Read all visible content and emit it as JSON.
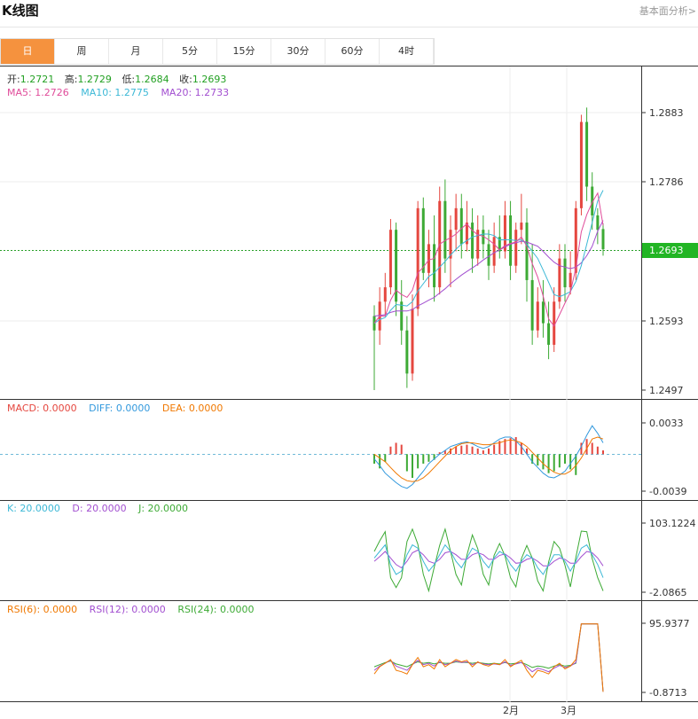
{
  "header": {
    "title": "K线图",
    "link": "基本面分析>"
  },
  "tabs": [
    {
      "label": "日",
      "active": true
    },
    {
      "label": "周"
    },
    {
      "label": "月"
    },
    {
      "label": "5分"
    },
    {
      "label": "15分"
    },
    {
      "label": "30分"
    },
    {
      "label": "60分"
    },
    {
      "label": "4时"
    }
  ],
  "colors": {
    "up": "#e5473f",
    "down": "#3daa35",
    "ma5": "#e04c9a",
    "ma10": "#3cb8d6",
    "ma20": "#a24fd0",
    "accent": "#f5923e",
    "dea": "#f07800",
    "diff": "#3399dd"
  },
  "info": {
    "open_label": "开:",
    "open": "1.2721",
    "high_label": "高:",
    "high": "1.2729",
    "low_label": "低:",
    "low": "1.2684",
    "close_label": "收:",
    "close": "1.2693",
    "ma5": "MA5: 1.2726",
    "ma10": "MA10: 1.2775",
    "ma20": "MA20: 1.2733"
  },
  "chart_data": [
    {
      "type": "candlestick",
      "title": "",
      "y_ticks": [
        "1.2883",
        "1.2786",
        "1.2693",
        "1.2593",
        "1.2497"
      ],
      "current_price": "1.2693",
      "ylim": [
        1.2497,
        1.291
      ],
      "x_ticks": [
        "2月",
        "3月"
      ],
      "ohlc": [
        [
          1.26,
          1.2615,
          1.2497,
          1.258
        ],
        [
          1.258,
          1.264,
          1.256,
          1.262
        ],
        [
          1.262,
          1.266,
          1.26,
          1.264
        ],
        [
          1.264,
          1.2735,
          1.263,
          1.272
        ],
        [
          1.272,
          1.273,
          1.26,
          1.262
        ],
        [
          1.262,
          1.265,
          1.256,
          1.258
        ],
        [
          1.258,
          1.26,
          1.25,
          1.252
        ],
        [
          1.252,
          1.263,
          1.251,
          1.261
        ],
        [
          1.261,
          1.276,
          1.26,
          1.275
        ],
        [
          1.275,
          1.2765,
          1.265,
          1.266
        ],
        [
          1.266,
          1.272,
          1.264,
          1.27
        ],
        [
          1.27,
          1.274,
          1.262,
          1.264
        ],
        [
          1.264,
          1.278,
          1.263,
          1.276
        ],
        [
          1.276,
          1.279,
          1.266,
          1.268
        ],
        [
          1.268,
          1.274,
          1.264,
          1.272
        ],
        [
          1.272,
          1.277,
          1.269,
          1.275
        ],
        [
          1.275,
          1.277,
          1.268,
          1.27
        ],
        [
          1.27,
          1.276,
          1.269,
          1.273
        ],
        [
          1.273,
          1.275,
          1.266,
          1.268
        ],
        [
          1.268,
          1.274,
          1.267,
          1.272
        ],
        [
          1.272,
          1.274,
          1.268,
          1.27
        ],
        [
          1.27,
          1.272,
          1.265,
          1.267
        ],
        [
          1.267,
          1.273,
          1.266,
          1.271
        ],
        [
          1.271,
          1.274,
          1.268,
          1.269
        ],
        [
          1.269,
          1.276,
          1.268,
          1.274
        ],
        [
          1.274,
          1.276,
          1.265,
          1.267
        ],
        [
          1.267,
          1.273,
          1.266,
          1.272
        ],
        [
          1.272,
          1.277,
          1.27,
          1.273
        ],
        [
          1.273,
          1.275,
          1.262,
          1.265
        ],
        [
          1.265,
          1.27,
          1.256,
          1.258
        ],
        [
          1.258,
          1.264,
          1.257,
          1.262
        ],
        [
          1.262,
          1.265,
          1.257,
          1.259
        ],
        [
          1.259,
          1.262,
          1.254,
          1.256
        ],
        [
          1.256,
          1.264,
          1.255,
          1.262
        ],
        [
          1.262,
          1.27,
          1.261,
          1.268
        ],
        [
          1.268,
          1.27,
          1.262,
          1.264
        ],
        [
          1.264,
          1.269,
          1.263,
          1.266
        ],
        [
          1.266,
          1.276,
          1.265,
          1.275
        ],
        [
          1.275,
          1.288,
          1.274,
          1.287
        ],
        [
          1.287,
          1.289,
          1.276,
          1.278
        ],
        [
          1.278,
          1.28,
          1.272,
          1.274
        ],
        [
          1.274,
          1.275,
          1.27,
          1.272
        ],
        [
          1.2721,
          1.2729,
          1.2684,
          1.2693
        ]
      ],
      "ma5": [
        1.259,
        1.26,
        1.26,
        1.2622,
        1.2636,
        1.263,
        1.2626,
        1.2636,
        1.266,
        1.2668,
        1.2678,
        1.268,
        1.27,
        1.2705,
        1.2709,
        1.2714,
        1.2722,
        1.2728,
        1.2719,
        1.2713,
        1.2711,
        1.2706,
        1.27,
        1.2692,
        1.2698,
        1.2701,
        1.2703,
        1.271,
        1.2697,
        1.2673,
        1.2654,
        1.2628,
        1.2596,
        1.2586,
        1.2602,
        1.2618,
        1.2633,
        1.2667,
        1.2717,
        1.2741,
        1.2758,
        1.2771,
        1.2726
      ],
      "ma10": [
        1.259,
        1.2595,
        1.2598,
        1.2608,
        1.2616,
        1.2615,
        1.2614,
        1.262,
        1.2635,
        1.2645,
        1.2655,
        1.266,
        1.2668,
        1.2676,
        1.2685,
        1.2693,
        1.27,
        1.2705,
        1.271,
        1.2712,
        1.2714,
        1.2714,
        1.2712,
        1.2706,
        1.2706,
        1.2706,
        1.2705,
        1.2706,
        1.27,
        1.269,
        1.268,
        1.2664,
        1.2647,
        1.263,
        1.2627,
        1.263,
        1.2634,
        1.2648,
        1.267,
        1.27,
        1.273,
        1.276,
        1.2775
      ],
      "ma20": [
        1.26,
        1.2601,
        1.2602,
        1.2605,
        1.2607,
        1.2607,
        1.2607,
        1.2609,
        1.2614,
        1.2618,
        1.2622,
        1.2626,
        1.2632,
        1.2638,
        1.2645,
        1.2651,
        1.2657,
        1.2662,
        1.2667,
        1.2672,
        1.2678,
        1.2683,
        1.2688,
        1.2692,
        1.2696,
        1.27,
        1.2702,
        1.2704,
        1.2703,
        1.27,
        1.2697,
        1.269,
        1.2682,
        1.2675,
        1.267,
        1.2668,
        1.2666,
        1.2668,
        1.2674,
        1.2684,
        1.2697,
        1.2718,
        1.2733
      ]
    },
    {
      "type": "bar",
      "name": "MACD",
      "legend": {
        "macd": "MACD: 0.0000",
        "diff": "DIFF: 0.0000",
        "dea": "DEA: 0.0000"
      },
      "y_ticks": [
        "0.0033",
        "-0.0039"
      ],
      "ylim": [
        -0.0039,
        0.0033
      ],
      "macd": [
        -0.001,
        -0.0015,
        -0.0008,
        0.0008,
        0.0012,
        0.001,
        -0.0018,
        -0.0025,
        -0.0015,
        -0.001,
        -0.0008,
        -0.0006,
        0.0002,
        0.0004,
        0.0006,
        0.0008,
        0.0009,
        0.001,
        0.0008,
        0.0006,
        0.0004,
        0.0006,
        0.001,
        0.0014,
        0.0016,
        0.0017,
        0.0018,
        0.0012,
        0.0006,
        -0.001,
        -0.0012,
        -0.0016,
        -0.002,
        -0.0018,
        -0.0014,
        -0.001,
        -0.0016,
        -0.0022,
        0.0012,
        0.0016,
        0.0012,
        0.0008,
        0.0004
      ],
      "diff": [
        -0.0005,
        -0.0012,
        -0.002,
        -0.0025,
        -0.003,
        -0.0034,
        -0.0036,
        -0.0032,
        -0.0025,
        -0.0018,
        -0.001,
        -0.0005,
        0.0,
        0.0004,
        0.0008,
        0.001,
        0.0012,
        0.0013,
        0.0011,
        0.0008,
        0.0006,
        0.0008,
        0.0012,
        0.0016,
        0.0018,
        0.0018,
        0.0014,
        0.0008,
        0.0,
        -0.0008,
        -0.0014,
        -0.002,
        -0.0024,
        -0.0025,
        -0.0022,
        -0.0018,
        -0.001,
        -0.0002,
        0.0008,
        0.002,
        0.003,
        0.0022,
        0.0012
      ],
      "dea": [
        0.0,
        -0.0004,
        -0.0008,
        -0.0014,
        -0.002,
        -0.0025,
        -0.0028,
        -0.0029,
        -0.0028,
        -0.0025,
        -0.002,
        -0.0014,
        -0.0008,
        -0.0002,
        0.0004,
        0.0008,
        0.0011,
        0.0012,
        0.0012,
        0.0011,
        0.001,
        0.001,
        0.0011,
        0.0012,
        0.0014,
        0.0015,
        0.0014,
        0.0012,
        0.0008,
        0.0002,
        -0.0004,
        -0.001,
        -0.0015,
        -0.0019,
        -0.0021,
        -0.0021,
        -0.0018,
        -0.0012,
        -0.0004,
        0.0006,
        0.0016,
        0.0018,
        0.0016
      ]
    },
    {
      "type": "line",
      "name": "KDJ",
      "legend": {
        "k": "K: 20.0000",
        "d": "D: 20.0000",
        "j": "J: 20.0000"
      },
      "y_ticks": [
        "103.1224",
        "-2.0865"
      ],
      "ylim": [
        -2.0865,
        103.1224
      ],
      "k": [
        50,
        60,
        70,
        40,
        25,
        30,
        55,
        70,
        65,
        45,
        30,
        40,
        55,
        70,
        60,
        45,
        35,
        50,
        65,
        60,
        45,
        35,
        50,
        60,
        55,
        40,
        30,
        45,
        55,
        50,
        35,
        25,
        40,
        55,
        55,
        45,
        30,
        45,
        65,
        70,
        55,
        40,
        20
      ],
      "d": [
        45,
        52,
        60,
        50,
        40,
        35,
        45,
        58,
        62,
        55,
        45,
        42,
        48,
        58,
        60,
        55,
        48,
        48,
        55,
        58,
        55,
        48,
        48,
        54,
        56,
        50,
        42,
        43,
        48,
        50,
        45,
        38,
        38,
        45,
        50,
        48,
        42,
        42,
        52,
        60,
        58,
        50,
        38
      ],
      "j": [
        60,
        76,
        90,
        20,
        5,
        20,
        75,
        94,
        71,
        25,
        0,
        36,
        69,
        94,
        60,
        25,
        9,
        54,
        85,
        64,
        25,
        9,
        54,
        72,
        53,
        20,
        6,
        49,
        69,
        50,
        15,
        0,
        44,
        75,
        65,
        39,
        6,
        51,
        91,
        90,
        49,
        20,
        0
      ]
    },
    {
      "type": "line",
      "name": "RSI",
      "legend": {
        "rsi6": "RSI(6): 0.0000",
        "rsi12": "RSI(12): 0.0000",
        "rsi24": "RSI(24): 0.0000"
      },
      "y_ticks": [
        "95.9377",
        "-0.8713"
      ],
      "ylim": [
        -0.8713,
        95.9377
      ],
      "rsi6": [
        25,
        35,
        40,
        45,
        30,
        28,
        25,
        38,
        48,
        35,
        38,
        32,
        45,
        35,
        40,
        45,
        42,
        44,
        35,
        42,
        38,
        36,
        40,
        38,
        45,
        35,
        40,
        44,
        30,
        20,
        30,
        28,
        25,
        35,
        40,
        32,
        36,
        45,
        95,
        95,
        95,
        95,
        0
      ],
      "rsi12": [
        30,
        36,
        40,
        44,
        36,
        33,
        30,
        38,
        44,
        38,
        40,
        36,
        42,
        38,
        40,
        43,
        41,
        42,
        38,
        41,
        39,
        38,
        39,
        38,
        42,
        37,
        39,
        41,
        35,
        28,
        33,
        31,
        28,
        33,
        37,
        34,
        36,
        41,
        95,
        95,
        95,
        95,
        0
      ],
      "rsi24": [
        35,
        38,
        41,
        43,
        39,
        37,
        35,
        39,
        42,
        40,
        41,
        39,
        41,
        40,
        40,
        42,
        41,
        41,
        40,
        41,
        40,
        39,
        40,
        39,
        41,
        39,
        40,
        41,
        38,
        34,
        36,
        35,
        33,
        36,
        38,
        36,
        37,
        40,
        95,
        95,
        95,
        95,
        0
      ]
    }
  ]
}
